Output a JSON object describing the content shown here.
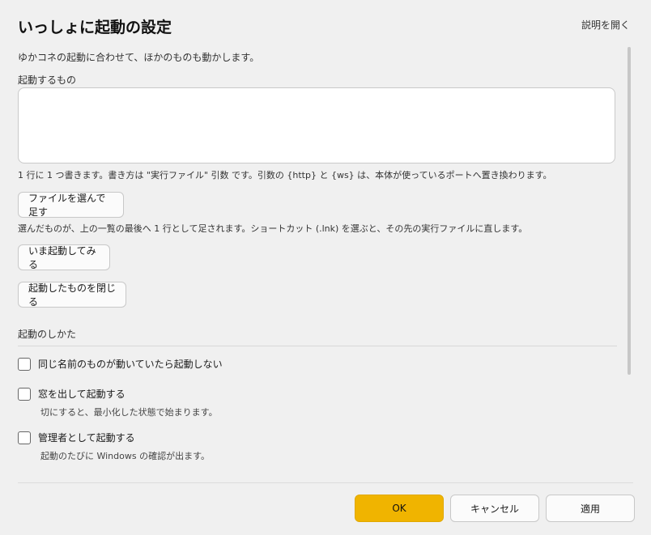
{
  "dialog": {
    "title": "いっしょに起動の設定",
    "help_link": "説明を開く",
    "description": "ゆかコネの起動に合わせて、ほかのものも動かします。"
  },
  "launch_list": {
    "label": "起動するもの",
    "value": "",
    "hint": "1 行に 1 つ書きます。書き方は \"実行ファイル\" 引数 です。引数の {http} と {ws} は、本体が使っているポートへ置き換わります。"
  },
  "buttons": {
    "pick_file": "ファイルを選んで足す",
    "pick_file_hint": "選んだものが、上の一覧の最後へ 1 行として足されます。ショートカット (.lnk) を選ぶと、その先の実行ファイルに直します。",
    "try_launch": "いま起動してみる",
    "close_launched": "起動したものを閉じる"
  },
  "launch_options": {
    "section_title": "起動のしかた",
    "skip_if_running": {
      "label": "同じ名前のものが動いていたら起動しない",
      "checked": false
    },
    "show_window": {
      "label": "窓を出して起動する",
      "sub": "切にすると、最小化した状態で始まります。",
      "checked": false
    },
    "run_as_admin": {
      "label": "管理者として起動する",
      "sub": "起動のたびに Windows の確認が出ます。",
      "checked": false
    }
  },
  "footer": {
    "ok": "OK",
    "cancel": "キャンセル",
    "apply": "適用"
  },
  "colors": {
    "accent": "#f0b400",
    "background": "#f0f0f0"
  }
}
